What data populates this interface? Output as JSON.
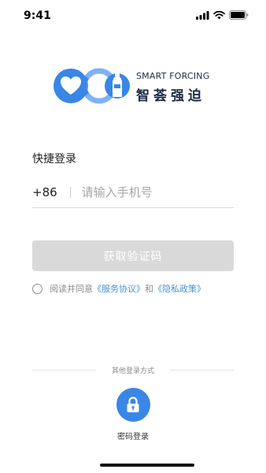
{
  "status_bar": {
    "time": "9:41",
    "icons": [
      "signal-icon",
      "wifi-icon",
      "battery-icon"
    ]
  },
  "logo": {
    "english": "SMART FORCING",
    "chinese": "智荟强迫",
    "colors": {
      "primary": "#3a86e6",
      "light": "#7fb2f2",
      "text": "#1f2a44"
    }
  },
  "login": {
    "title": "快捷登录",
    "country_code": "+86",
    "phone_placeholder": "请输入手机号",
    "get_code_label": "获取验证码"
  },
  "agreement": {
    "prefix": "阅读并同意",
    "service_link": "《服务协议》",
    "conjunction": "和",
    "privacy_link": "《隐私政策》"
  },
  "other_login": {
    "title": "其他登录方式",
    "password_login_label": "密码登录",
    "password_icon": "lock-icon"
  },
  "colors": {
    "accent": "#3a86e6",
    "link": "#4a90d9",
    "button_disabled": "#d9d9d9"
  }
}
